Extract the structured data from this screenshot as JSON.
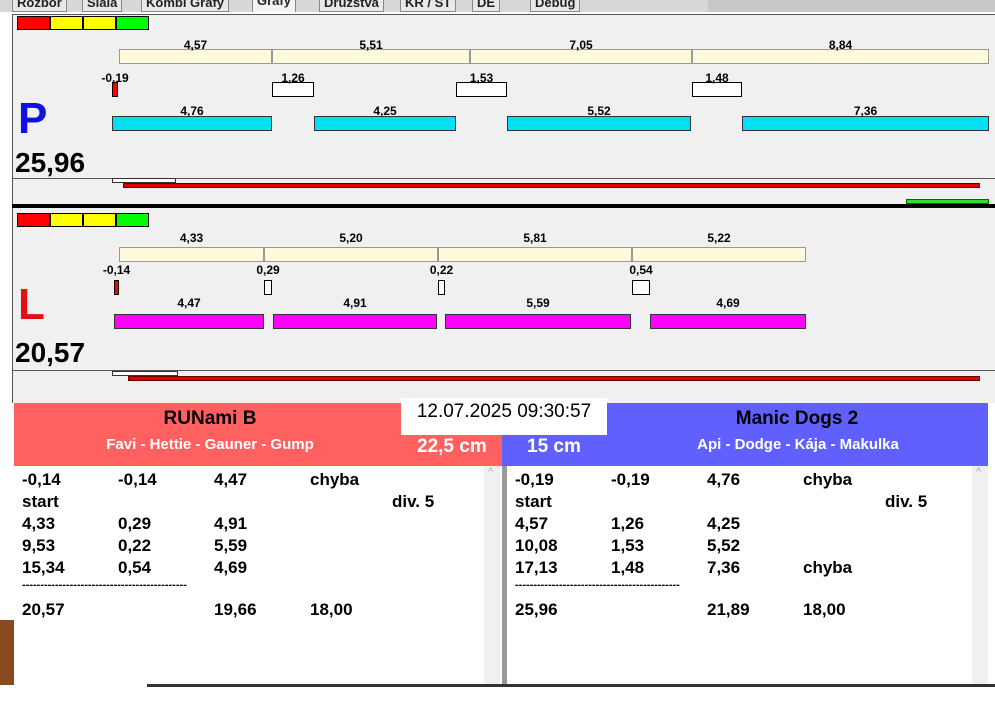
{
  "tabs": [
    "Rozbor",
    "Síala",
    "Kombi Grafy",
    "Grafy",
    "Družstva",
    "KR / ST",
    "DE",
    "Debug"
  ],
  "active_tab": "Grafy",
  "lights": [
    "#ff0000",
    "#ffff00",
    "#ffff00",
    "#00ff00"
  ],
  "lanes": [
    {
      "letter": "P",
      "letter_color": "#1010e0",
      "run_color": "#00e0f0",
      "total": "25,96",
      "splits": [
        "4,57",
        "5,51",
        "7,05",
        "8,84"
      ],
      "reactions": [
        "-0,19",
        "1,26",
        "1,53",
        "1,48"
      ],
      "runs": [
        "4,76",
        "4,25",
        "5,52",
        "7,36"
      ],
      "progress_red": 0.99,
      "progress_green": true
    },
    {
      "letter": "L",
      "letter_color": "#e01010",
      "run_color": "#ff00ff",
      "total": "20,57",
      "splits": [
        "4,33",
        "5,20",
        "5,81",
        "5,22"
      ],
      "reactions": [
        "-0,14",
        "0,29",
        "0,22",
        "0,54"
      ],
      "runs": [
        "4,47",
        "4,91",
        "5,59",
        "4,69"
      ],
      "progress_red": 0.99,
      "progress_green": false
    }
  ],
  "datetime": "12.07.2025 09:30:57",
  "left_team": {
    "name": "RUNami B",
    "dogs": "Favi - Hettie - Gauner - Gump",
    "distance": "22,5 cm",
    "color": "#ff6060",
    "rows": [
      [
        "-0,14",
        "-0,14",
        "4,47",
        "chyba",
        ""
      ],
      [
        "start",
        "",
        "",
        "",
        "div.  5"
      ],
      [
        "4,33",
        "0,29",
        "4,91",
        "",
        ""
      ],
      [
        "9,53",
        "0,22",
        "5,59",
        "",
        ""
      ],
      [
        "15,34",
        "0,54",
        "4,69",
        "",
        ""
      ],
      [
        "---------------------------------------------",
        "",
        "",
        "",
        ""
      ],
      [
        "20,57",
        "",
        "19,66",
        "18,00",
        ""
      ]
    ]
  },
  "right_team": {
    "name": "Manic Dogs 2",
    "dogs": "Api - Dodge - Kája - Makulka",
    "distance": "15 cm",
    "color": "#6060ff",
    "rows": [
      [
        "-0,19",
        "-0,19",
        "4,76",
        "chyba",
        ""
      ],
      [
        "start",
        "",
        "",
        "",
        "div.  5"
      ],
      [
        "4,57",
        "1,26",
        "4,25",
        "",
        ""
      ],
      [
        "10,08",
        "1,53",
        "5,52",
        "",
        ""
      ],
      [
        "17,13",
        "1,48",
        "7,36",
        "chyba",
        ""
      ],
      [
        "---------------------------------------------",
        "",
        "",
        "",
        ""
      ],
      [
        "25,96",
        "",
        "21,89",
        "18,00",
        ""
      ]
    ]
  }
}
